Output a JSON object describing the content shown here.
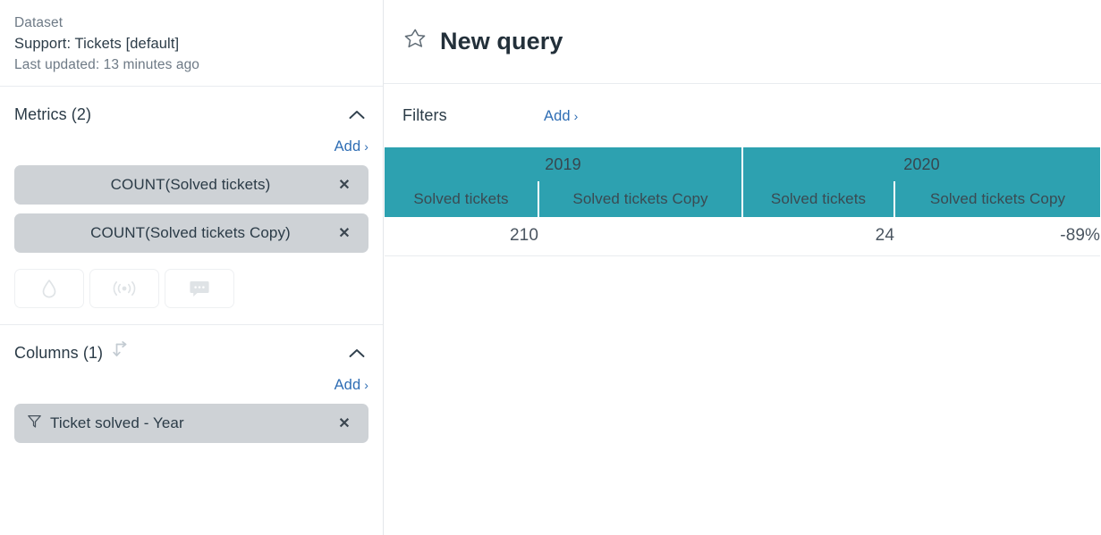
{
  "sidebar": {
    "dataset": {
      "label": "Dataset",
      "name": "Support: Tickets [default]",
      "updated": "Last updated: 13 minutes ago"
    },
    "metrics": {
      "title": "Metrics (2)",
      "add_label": "Add",
      "add_chevron": "›",
      "collapse_icon": "chevron-up",
      "chips": [
        {
          "label": "COUNT(Solved tickets)",
          "remove": "✕"
        },
        {
          "label": "COUNT(Solved tickets Copy)",
          "remove": "✕"
        }
      ],
      "icon_buttons": [
        {
          "name": "droplet-icon"
        },
        {
          "name": "signal-icon"
        },
        {
          "name": "comment-icon"
        }
      ]
    },
    "columns": {
      "title": "Columns (1)",
      "swap_icon": "swap-arrows-icon",
      "add_label": "Add",
      "add_chevron": "›",
      "collapse_icon": "chevron-up",
      "chips": [
        {
          "label": "Ticket solved - Year",
          "icon": "funnel-icon",
          "remove": "✕"
        }
      ]
    }
  },
  "main": {
    "header": {
      "star_icon": "star-outline-icon",
      "title": "New query"
    },
    "filters": {
      "label": "Filters",
      "add_label": "Add",
      "add_chevron": "›"
    }
  },
  "colors": {
    "teal_header": "#2da1b0",
    "chip_gray": "#ced2d6",
    "link_blue": "#2e6db4",
    "text_dark": "#2b3b47",
    "text_muted": "#6e7a86"
  },
  "chart_data": {
    "type": "table",
    "title": "New query",
    "column_groups": [
      {
        "label": "2019",
        "span": 2
      },
      {
        "label": "2020",
        "span": 2
      }
    ],
    "columns": [
      "Solved tickets",
      "Solved tickets Copy",
      "Solved tickets",
      "Solved tickets Copy"
    ],
    "rows": [
      [
        "210",
        "",
        "24",
        "-89%"
      ]
    ]
  }
}
